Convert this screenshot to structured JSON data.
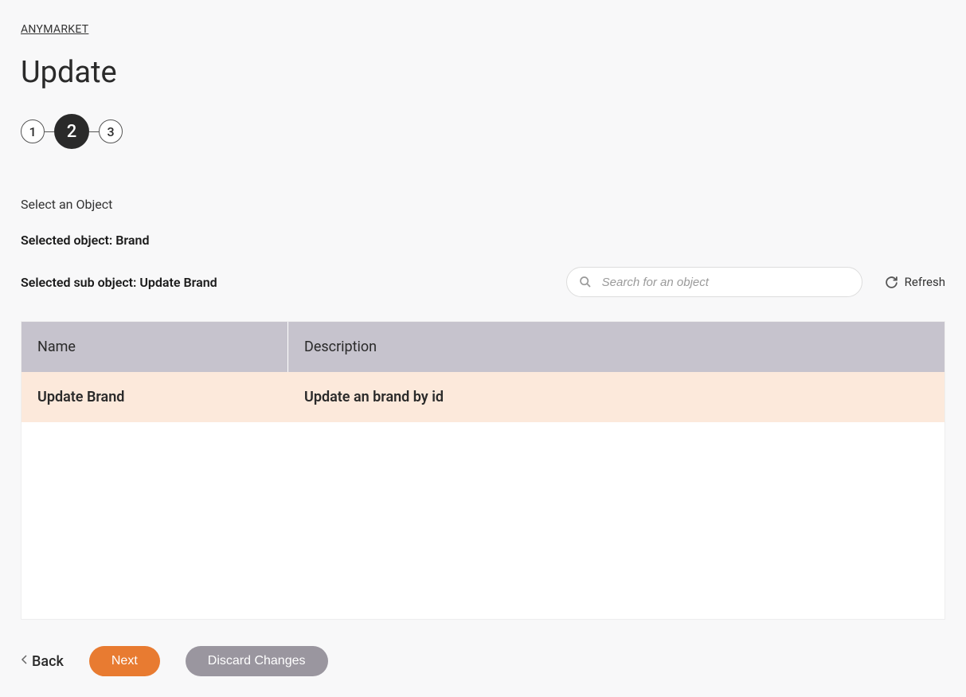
{
  "breadcrumb": "ANYMARKET",
  "page_title": "Update",
  "stepper": {
    "steps": [
      "1",
      "2",
      "3"
    ],
    "active_index": 1
  },
  "section": {
    "label": "Select an Object",
    "selected_object_prefix": "Selected object: ",
    "selected_object_value": "Brand",
    "selected_sub_prefix": "Selected sub object: ",
    "selected_sub_value": "Update Brand"
  },
  "search": {
    "placeholder": "Search for an object"
  },
  "refresh_label": "Refresh",
  "table": {
    "headers": {
      "name": "Name",
      "description": "Description"
    },
    "rows": [
      {
        "name": "Update Brand",
        "description": "Update an brand by id",
        "selected": true
      }
    ]
  },
  "footer": {
    "back": "Back",
    "next": "Next",
    "discard": "Discard Changes"
  }
}
